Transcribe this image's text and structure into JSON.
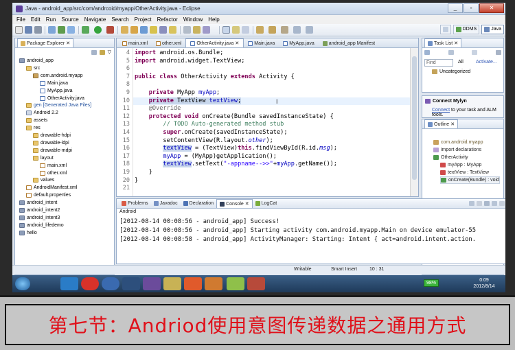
{
  "window": {
    "title": "Java - android_app/src/com/andrcoid/myapp/OtherActivity.java - Eclipse"
  },
  "menubar": [
    "File",
    "Edit",
    "Run",
    "Source",
    "Navigate",
    "Search",
    "Project",
    "Refactor",
    "Window",
    "Help"
  ],
  "perspectives": {
    "ddms": "DDMS",
    "java": "Java"
  },
  "package_explorer": {
    "title": "Package Explorer",
    "items": [
      {
        "label": "android_app",
        "icon": "project-icon"
      },
      {
        "label": "src",
        "icon": "folder-icon"
      },
      {
        "label": "com.android.myapp",
        "icon": "package-icon"
      },
      {
        "label": "Main.java",
        "icon": "java-file-icon"
      },
      {
        "label": "MyApp.java",
        "icon": "java-file-icon"
      },
      {
        "label": "OtherActivity.java",
        "icon": "java-file-icon"
      },
      {
        "label": "gen [Generated Java Files]",
        "icon": "folder-icon"
      },
      {
        "label": "Android 2.2",
        "icon": "library-icon"
      },
      {
        "label": "assets",
        "icon": "folder-icon"
      },
      {
        "label": "res",
        "icon": "folder-icon"
      },
      {
        "label": "drawable-hdpi",
        "icon": "folder-icon"
      },
      {
        "label": "drawable-ldpi",
        "icon": "folder-icon"
      },
      {
        "label": "drawable-mdpi",
        "icon": "folder-icon"
      },
      {
        "label": "layout",
        "icon": "folder-icon"
      },
      {
        "label": "main.xml",
        "icon": "xml-file-icon"
      },
      {
        "label": "other.xml",
        "icon": "xml-file-icon"
      },
      {
        "label": "values",
        "icon": "folder-icon"
      },
      {
        "label": "AndroidManifest.xml",
        "icon": "xml-file-icon"
      },
      {
        "label": "default.properties",
        "icon": "file-icon"
      },
      {
        "label": "android_intent",
        "icon": "project-icon"
      },
      {
        "label": "android_intent2",
        "icon": "project-icon"
      },
      {
        "label": "android_intent3",
        "icon": "project-icon"
      },
      {
        "label": "android_lifedemo",
        "icon": "project-icon"
      },
      {
        "label": "hello",
        "icon": "project-icon"
      }
    ]
  },
  "editor": {
    "tabs": [
      "main.xml",
      "other.xml",
      "OtherActivity.java",
      "Main.java",
      "MyApp.java",
      "android_app Manifest"
    ],
    "active_tab": "OtherActivity.java",
    "line_numbers": [
      "4",
      "5",
      "6",
      "7",
      "8",
      "9",
      "10",
      "11",
      "12",
      "13",
      "14",
      "15",
      "16",
      "17",
      "18",
      "19",
      "20",
      "21"
    ],
    "code": {
      "l4_kw": "import",
      "l4_rest": " android.os.Bundle;",
      "l5_kw": "import",
      "l5_rest": " android.widget.TextView;",
      "l7_kw1": "public",
      "l7_kw2": " class",
      "l7_mid": " OtherActivity ",
      "l7_kw3": "extends",
      "l7_end": " Activity {",
      "l9_kw": "private",
      "l9_type": " MyApp ",
      "l9_fld": "myApp",
      "l9_end": ";",
      "l10_kw": "private",
      "l10_type": " TextView ",
      "l10_fld": "textView",
      "l10_end": ";",
      "l11_ann": "@Override",
      "l12_kw1": "protected",
      "l12_kw2": " void",
      "l12_rest": " onCreate(Bundle savedInstanceState) {",
      "l13_cmt": "// TODO Auto-generated method stub",
      "l14_kw": "super",
      "l14_rest": ".onCreate(savedInstanceState);",
      "l15_a": "setContentView(R.layout.",
      "l15_fld": "other",
      "l15_b": ");",
      "l16_fld": "textView",
      "l16_a": " = (TextView)",
      "l16_kw": "this",
      "l16_b": ".findViewById(R.id.",
      "l16_fld2": "msg",
      "l16_c": ");",
      "l17_fld": "myApp",
      "l17_rest": " = (MyApp)getApplication();",
      "l18_fld": "textView",
      "l18_a": ".setText(",
      "l18_str": "\"-appname-->>\"",
      "l18_b": "+",
      "l18_fld2": "myApp",
      "l18_c": ".getName());",
      "l19": "}",
      "l20": "}"
    }
  },
  "task_list": {
    "title": "Task List",
    "find_placeholder": "Find",
    "all": "All",
    "activate": "Activate...",
    "uncategorized": "Uncategorized"
  },
  "mylyn": {
    "title": "Connect Mylyn",
    "link": "Connect",
    "text": " to your task and ALM tools."
  },
  "outline": {
    "title": "Outline",
    "items": [
      {
        "label": "com.android.myapp",
        "color": "#6b5a2e"
      },
      {
        "label": "import declarations",
        "color": "#222222"
      },
      {
        "label": "OtherActivity",
        "color": "#222222"
      },
      {
        "label": "myApp : MyApp",
        "color": "#222222"
      },
      {
        "label": "textView : TextView",
        "color": "#222222"
      },
      {
        "label": "onCreate(Bundle) : void",
        "color": "#222222"
      }
    ]
  },
  "console": {
    "tabs": [
      "Problems",
      "Javadoc",
      "Declaration",
      "Console",
      "LogCat"
    ],
    "active_tab": "Console",
    "header": "Android",
    "lines": [
      "[2012-08-14 00:08:56 - android_app] Success!",
      "[2012-08-14 00:08:56 - android_app] Starting activity com.android.myapp.Main on device emulator-55",
      "[2012-08-14 00:08:58 - android_app] ActivityManager: Starting: Intent { act=android.intent.action."
    ]
  },
  "statusbar": {
    "mode": "Writable",
    "insert": "Smart Insert",
    "position": "10 : 31"
  },
  "taskbar": {
    "battery": "98%",
    "time": "0:09",
    "date": "2012/8/14"
  },
  "banner": {
    "text": "第七节：Andriod使用意图传递数据之通用方式"
  }
}
